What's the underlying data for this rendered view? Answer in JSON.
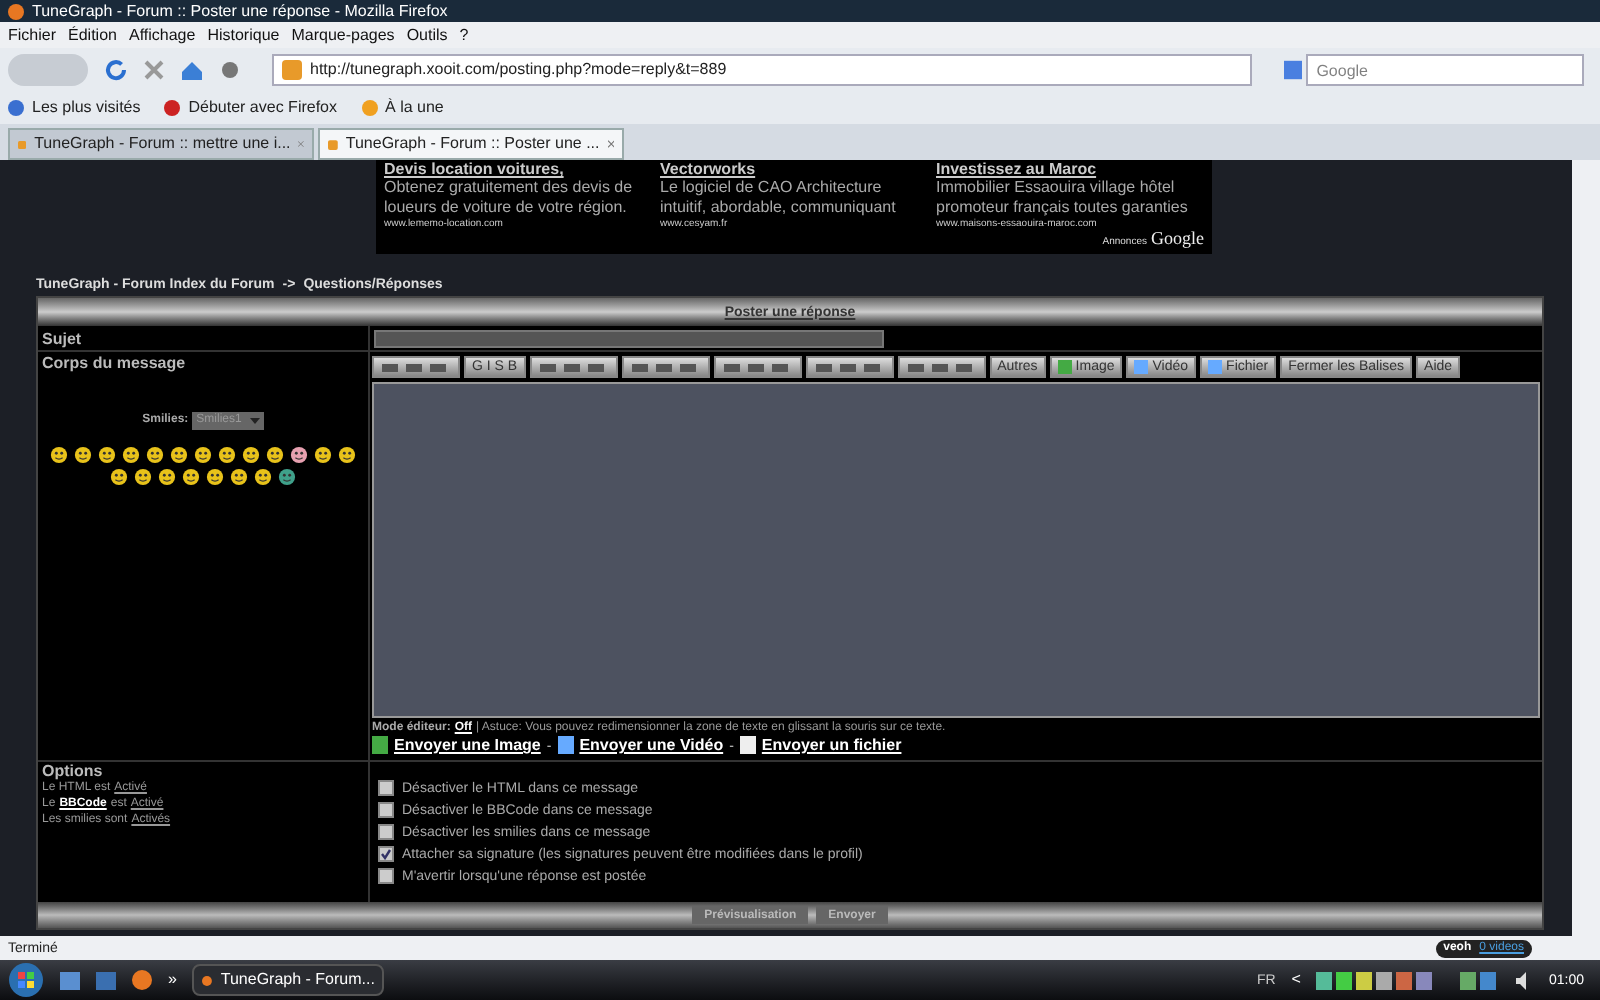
{
  "window": {
    "title": "TuneGraph - Forum :: Poster une réponse - Mozilla Firefox"
  },
  "menu": [
    "Fichier",
    "Édition",
    "Affichage",
    "Historique",
    "Marque-pages",
    "Outils",
    "?"
  ],
  "address": {
    "value": "http://tunegraph.xooit.com/posting.php?mode=reply&t=889"
  },
  "search": {
    "placeholder": "Google"
  },
  "bookmarks": [
    "Les plus visités",
    "Débuter avec Firefox",
    "À la une"
  ],
  "tabs": [
    {
      "label": "TuneGraph - Forum :: mettre une i...",
      "selected": false
    },
    {
      "label": "TuneGraph - Forum :: Poster une ...",
      "selected": true
    }
  ],
  "ads": [
    {
      "title": "Devis location voitures,",
      "text": "Obtenez gratuitement des devis de loueurs de voiture de votre région.",
      "url": "www.lememo-location.com"
    },
    {
      "title": "Vectorworks",
      "text": "Le logiciel de CAO Architecture intuitif, abordable, communiquant",
      "url": "www.cesyam.fr"
    },
    {
      "title": "Investissez au Maroc",
      "text": "Immobilier Essaouira village hôtel promoteur français toutes garanties",
      "url": "www.maisons-essaouira-maroc.com"
    }
  ],
  "ads_label": "Annonces",
  "ads_brand": "Google",
  "breadcrumb": {
    "start": "TuneGraph - Forum Index du Forum",
    "sep": "->",
    "current": "Questions/Réponses"
  },
  "form": {
    "title": "Poster une réponse",
    "subject_label": "Sujet",
    "body_label": "Corps du message",
    "smilies_label": "Smilies:",
    "smilies_value": "Smilies1",
    "smileys": [
      {
        "color": "#e8c21a"
      },
      {
        "color": "#e8c21a"
      },
      {
        "color": "#e8c21a"
      },
      {
        "color": "#e8c21a"
      },
      {
        "color": "#e8c21a"
      },
      {
        "color": "#e8c21a"
      },
      {
        "color": "#e8c21a"
      },
      {
        "color": "#e8c21a"
      },
      {
        "color": "#e8c21a"
      },
      {
        "color": "#e8c21a"
      },
      {
        "color": "#e7a0b0"
      },
      {
        "color": "#e8c21a"
      },
      {
        "color": "#e8c21a"
      },
      {
        "color": "#e8c21a"
      },
      {
        "color": "#e8c21a"
      },
      {
        "color": "#e8c21a"
      },
      {
        "color": "#e8c21a"
      },
      {
        "color": "#e8c21a"
      },
      {
        "color": "#e8c21a"
      },
      {
        "color": "#e8c21a"
      },
      {
        "color": "#3fa08a"
      }
    ],
    "toolbar": [
      {
        "kind": "icons"
      },
      {
        "kind": "text",
        "label": "G I S B"
      },
      {
        "kind": "icons"
      },
      {
        "kind": "icons"
      },
      {
        "kind": "icons"
      },
      {
        "kind": "icons"
      },
      {
        "kind": "icons"
      },
      {
        "kind": "text",
        "label": "Autres"
      },
      {
        "kind": "icontext",
        "label": "Image"
      },
      {
        "kind": "icontext",
        "label": "Vidéo"
      },
      {
        "kind": "icontext",
        "label": "Fichier"
      },
      {
        "kind": "text",
        "label": "Fermer les Balises"
      },
      {
        "kind": "text",
        "label": "Aide"
      }
    ],
    "editor_mode_label": "Mode éditeur:",
    "editor_mode_value": "Off",
    "tip": "| Astuce: Vous pouvez redimensionner la zone de texte en glissant la souris sur ce texte.",
    "uploads": [
      "Envoyer une Image",
      "Envoyer une Vidéo",
      "Envoyer un fichier"
    ],
    "upload_sep": "-",
    "options_title": "Options",
    "options_info": [
      {
        "kind": "plain",
        "before": "Le HTML est",
        "link": "Activé"
      },
      {
        "kind": "bbcode",
        "before": "Le",
        "bold_word": "BBCode",
        "after": "est",
        "link": "Activé"
      },
      {
        "kind": "plain",
        "before": "Les smilies sont",
        "link": "Activés"
      }
    ],
    "options": [
      {
        "label": "Désactiver le HTML dans ce message",
        "checked": false
      },
      {
        "label": "Désactiver le BBCode dans ce message",
        "checked": false
      },
      {
        "label": "Désactiver les smilies dans ce message",
        "checked": false
      },
      {
        "label": "Attacher sa signature (les signatures peuvent être modifiées dans le profil)",
        "checked": true
      },
      {
        "label": "M'avertir lorsqu'une réponse est postée",
        "checked": false
      }
    ],
    "buttons": [
      "Prévisualisation",
      "Envoyer"
    ]
  },
  "status_bar": {
    "text": "Terminé",
    "veoh": "veoh",
    "videos": "0 videos"
  },
  "taskbar": {
    "more": "»",
    "task": "TuneGraph - Forum...",
    "lang": "FR",
    "chevron": "<",
    "clock": "01:00"
  }
}
